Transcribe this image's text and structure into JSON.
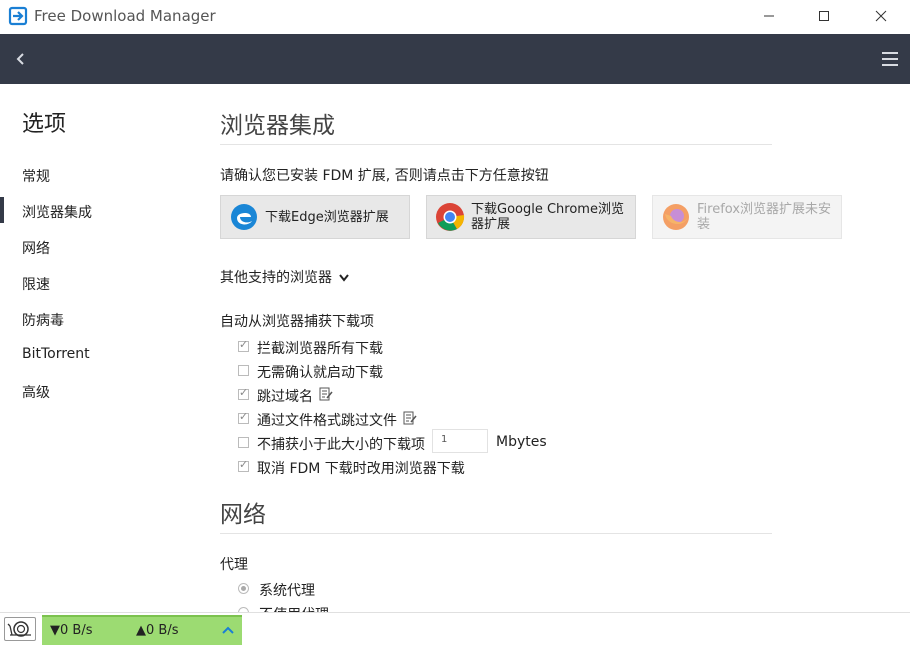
{
  "window": {
    "title": "Free Download Manager",
    "min": "—",
    "max": "☐",
    "close": "✕"
  },
  "sidebar": {
    "title": "选项",
    "items": [
      {
        "label": "常规"
      },
      {
        "label": "浏览器集成"
      },
      {
        "label": "网络"
      },
      {
        "label": "限速"
      },
      {
        "label": "防病毒"
      },
      {
        "label": "BitTorrent"
      },
      {
        "label": "高级"
      }
    ],
    "active_index": 1
  },
  "browser": {
    "title": "浏览器集成",
    "prompt": "请确认您已安装 FDM 扩展, 否则请点击下方任意按钮",
    "buttons": [
      {
        "label": "下载Edge浏览器扩展",
        "icon": "edge-icon",
        "enabled": true
      },
      {
        "label": "下载Google Chrome浏览器扩展",
        "icon": "chrome-icon",
        "enabled": true
      },
      {
        "label": "Firefox浏览器扩展未安装",
        "icon": "firefox-icon",
        "enabled": false
      }
    ],
    "other_browsers": "其他支持的浏览器",
    "capture_heading": "自动从浏览器捕获下载项",
    "options": [
      {
        "label": "拦截浏览器所有下载",
        "checked": true
      },
      {
        "label": "无需确认就启动下载",
        "checked": false
      },
      {
        "label": "跳过域名",
        "checked": true
      },
      {
        "label": "通过文件格式跳过文件",
        "checked": true
      },
      {
        "label": "不捕获小于此大小的下载项",
        "checked": false
      },
      {
        "label": "取消 FDM 下载时改用浏览器下载",
        "checked": true
      }
    ],
    "min_size_value": "1",
    "min_size_unit": "Mbytes"
  },
  "network": {
    "title": "网络",
    "proxy_heading": "代理",
    "proxy_options": [
      {
        "label": "系统代理",
        "selected": true
      },
      {
        "label": "不使用代理",
        "selected": false
      }
    ]
  },
  "status": {
    "download_speed": "▼0 B/s",
    "upload_speed": "▲0 B/s"
  },
  "colors": {
    "toolbar": "#343a48",
    "speed_bar": "#9cdb72",
    "accent": "#1a7fd4"
  }
}
